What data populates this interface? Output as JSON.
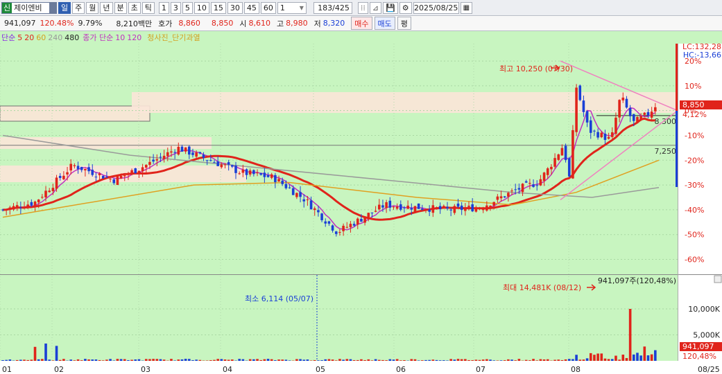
{
  "toolbar": {
    "market_badge": "신",
    "stock_name": "제이엔비",
    "periods": [
      "일",
      "주",
      "월",
      "년",
      "분",
      "초",
      "틱"
    ],
    "selected_period": "일",
    "intervals": [
      "1",
      "3",
      "5",
      "10",
      "15",
      "30",
      "45",
      "60"
    ],
    "interval_value": "1",
    "count": "183/425",
    "date": "2025/08/25"
  },
  "quote": {
    "volume": "941,097",
    "volume_ratio": "120.48%",
    "turnover_rate": "9.79%",
    "trade_value": "8,210백만",
    "bid_label": "호가",
    "bid": "8,860",
    "ask": "8,850",
    "open_label": "시",
    "open": "8,610",
    "high_label": "고",
    "high": "8,980",
    "low_label": "저",
    "low": "8,320",
    "buy_label": "매수",
    "sell_label": "매도",
    "avg_label": "평"
  },
  "legend": {
    "ma_label": "단순",
    "ma_periods": [
      {
        "text": "5",
        "color": "#e0241b"
      },
      {
        "text": "20",
        "color": "#e0241b"
      },
      {
        "text": "60",
        "color": "#d4a020"
      },
      {
        "text": "240",
        "color": "#9a9a9a"
      },
      {
        "text": "480",
        "color": "#222222"
      }
    ],
    "vol_ma_label": "종가 단순",
    "vol_ma_periods": [
      {
        "text": "10",
        "color": "#c030c0"
      },
      {
        "text": "120",
        "color": "#c030c0"
      }
    ],
    "indicator": "청사진_단기과열"
  },
  "chart_data": {
    "type": "candlestick",
    "colors": {
      "up": "#e0241b",
      "down": "#1a3fd6",
      "bg": "#c8f5c0",
      "ma5": "#e0241b",
      "ma10": "#c030c0",
      "ma60": "#e0a020",
      "ma240": "#9a9a9a"
    },
    "price_axis_labels": [
      "20%",
      "10%",
      "0%",
      "-10%",
      "-20%",
      "-30%",
      "-40%",
      "-50%",
      "-60%"
    ],
    "price_axis_values": [
      20,
      10,
      0,
      -10,
      -20,
      -30,
      -40,
      -50,
      -60
    ],
    "pct_range": [
      -66,
      27
    ],
    "right_labels": {
      "lc": "LC:132,28",
      "hc": "HC:-13,66",
      "price": "8,850",
      "pct": "4,12%"
    },
    "level_lines": [
      {
        "label": "8,300",
        "pct": -2
      },
      {
        "label": "7,250",
        "pct": -14
      }
    ],
    "max_annotation": "최고 10,250 (07/30)",
    "month_labels": [
      "01",
      "02",
      "03",
      "04",
      "05",
      "06",
      "07",
      "08",
      "08/25"
    ],
    "volume": {
      "annotations": {
        "min": "최소 6,114 (05/07)",
        "max": "최대 14,481K (08/12)",
        "last": "941,097주(120,48%)"
      },
      "axis_labels": [
        "10,000K",
        "5,000K"
      ],
      "axis_values": [
        10000,
        5000
      ],
      "max_value": 15200,
      "current_label": "941,097",
      "current_pct": "120,48%"
    }
  }
}
